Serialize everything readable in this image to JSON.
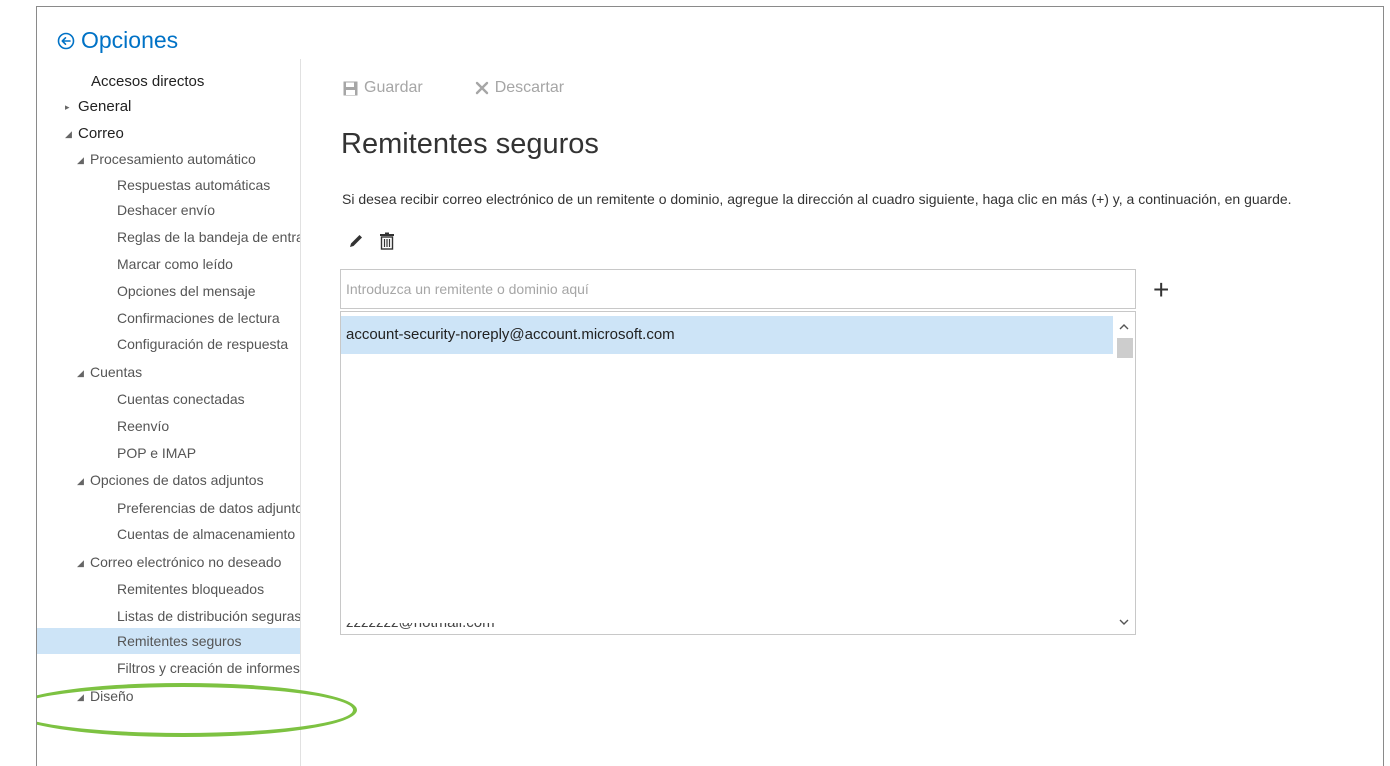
{
  "app": {
    "title": "Opciones"
  },
  "sidebar": {
    "items": [
      {
        "label": "Accesos directos",
        "level": 0,
        "arrow": ""
      },
      {
        "label": "General",
        "level": 0,
        "arrow": "collapsed"
      },
      {
        "label": "Correo",
        "level": 0,
        "arrow": "expanded"
      },
      {
        "label": "Procesamiento automático",
        "level": 1,
        "arrow": "expanded"
      },
      {
        "label": "Respuestas automáticas",
        "level": 2,
        "arrow": ""
      },
      {
        "label": "Deshacer envío",
        "level": 2,
        "arrow": ""
      },
      {
        "label": "Reglas de la bandeja de entrada",
        "level": 2,
        "arrow": ""
      },
      {
        "label": "Marcar como leído",
        "level": 2,
        "arrow": ""
      },
      {
        "label": "Opciones del mensaje",
        "level": 2,
        "arrow": ""
      },
      {
        "label": "Confirmaciones de lectura",
        "level": 2,
        "arrow": ""
      },
      {
        "label": "Configuración de respuesta",
        "level": 2,
        "arrow": ""
      },
      {
        "label": "Cuentas",
        "level": 1,
        "arrow": "expanded"
      },
      {
        "label": "Cuentas conectadas",
        "level": 2,
        "arrow": ""
      },
      {
        "label": "Reenvío",
        "level": 2,
        "arrow": ""
      },
      {
        "label": "POP e IMAP",
        "level": 2,
        "arrow": ""
      },
      {
        "label": "Opciones de datos adjuntos",
        "level": 1,
        "arrow": "expanded"
      },
      {
        "label": "Preferencias de datos adjuntos",
        "level": 2,
        "arrow": ""
      },
      {
        "label": "Cuentas de almacenamiento",
        "level": 2,
        "arrow": ""
      },
      {
        "label": "Correo electrónico no deseado",
        "level": 1,
        "arrow": "expanded"
      },
      {
        "label": "Remitentes bloqueados",
        "level": 2,
        "arrow": ""
      },
      {
        "label": "Listas de distribución seguras",
        "level": 2,
        "arrow": ""
      },
      {
        "label": "Remitentes seguros",
        "level": 2,
        "arrow": "",
        "selected": true
      },
      {
        "label": "Filtros y creación de informes",
        "level": 2,
        "arrow": ""
      },
      {
        "label": "Diseño",
        "level": 1,
        "arrow": "expanded"
      }
    ]
  },
  "toolbar": {
    "save_label": "Guardar",
    "discard_label": "Descartar"
  },
  "main": {
    "title": "Remitentes seguros",
    "description": "Si desea recibir correo electrónico de un remitente o dominio, agregue la dirección al cuadro siguiente, haga clic en más (+) y, a continuación, en guarde.",
    "input_placeholder": "Introduzca un remitente o dominio aquí",
    "add_label": "+",
    "senders": [
      "account-security-noreply@account.microsoft.com"
    ],
    "partial_sender": "zzzzzzz@hotmail.com"
  },
  "colors": {
    "accent": "#0072c6",
    "selected": "#cde4f7",
    "highlight_ring": "#7dc242"
  },
  "icons": [
    "back-circle-icon",
    "save-icon",
    "discard-icon",
    "edit-pencil-icon",
    "trash-icon",
    "add-icon",
    "scroll-up-icon",
    "scroll-down-icon"
  ]
}
